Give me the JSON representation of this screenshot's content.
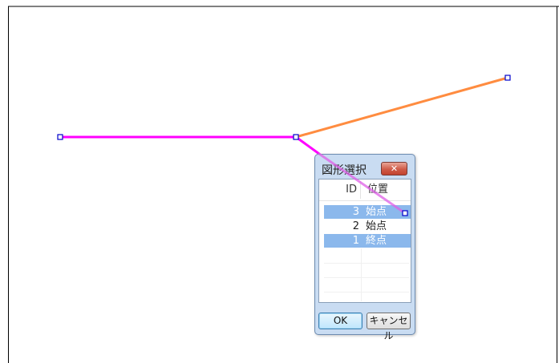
{
  "canvas": {
    "line_colors": {
      "magenta": "#ff00ff",
      "orange": "#ff8c40"
    },
    "vertex_color": "#0000cc"
  },
  "dialog": {
    "title": "図形選択",
    "close_label": "✕",
    "columns": {
      "id": "ID",
      "position": "位置"
    },
    "rows": [
      {
        "id": "3",
        "position": "始点",
        "selected": true
      },
      {
        "id": "2",
        "position": "始点",
        "selected": false
      },
      {
        "id": "1",
        "position": "終点",
        "selected": true
      }
    ],
    "ok_label": "OK",
    "cancel_label": "キャンセル",
    "selection_color": "#8bb8ec"
  }
}
